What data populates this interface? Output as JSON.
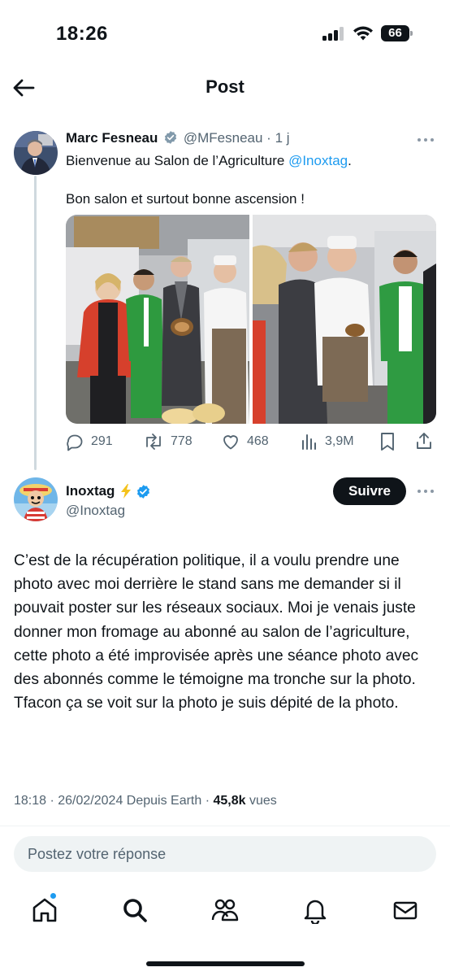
{
  "status_bar": {
    "time": "18:26",
    "battery": "66"
  },
  "header": {
    "title": "Post"
  },
  "parent_post": {
    "author_name": "Marc Fesneau",
    "handle": "@MFesneau",
    "separator": "·",
    "time_ago": "1 j",
    "text_before_mention": "Bienvenue au Salon de l’Agriculture ",
    "mention": "@Inoxtag",
    "text_after_mention": ".",
    "line2": "Bon salon et surtout bonne ascension !",
    "stats": {
      "replies": "291",
      "reposts": "778",
      "likes": "468",
      "views": "3,9M"
    }
  },
  "main_post": {
    "author_name": "Inoxtag",
    "handle": "@Inoxtag",
    "follow_label": "Suivre",
    "body": "C’est de la récupération politique, il a voulu prendre une photo avec moi derrière le stand sans me demander si il pouvait poster sur les réseaux sociaux. Moi je venais juste donner mon fromage au abonné au salon de l’agriculture, cette photo a été improvisée après une séance photo avec des abonnés comme le témoigne ma tronche sur la photo.\nTfacon ça se voit sur la photo je suis dépité de la photo.",
    "meta_time": "18:18 · 26/02/2024 Depuis Earth · ",
    "meta_views_count": "45,8k",
    "meta_views_label": " vues"
  },
  "reply": {
    "placeholder": "Postez votre réponse"
  },
  "tabs": [
    "home-icon",
    "search-icon",
    "communities-icon",
    "notifications-icon",
    "messages-icon"
  ],
  "colors": {
    "accent": "#1d9bf0",
    "text": "#0f1419",
    "muted": "#536471",
    "verified": "#1d9bf0",
    "lightning": "#f4c21b"
  }
}
